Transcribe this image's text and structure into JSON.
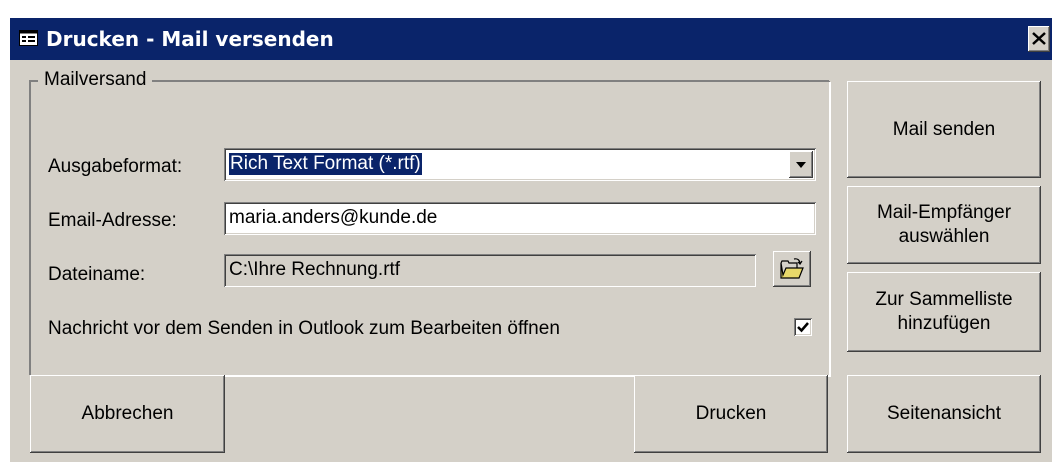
{
  "window": {
    "title": "Drucken - Mail versenden",
    "icon": "form-icon",
    "close_label": "close"
  },
  "group": {
    "legend": "Mailversand"
  },
  "format": {
    "label": "Ausgabeformat:",
    "value": "Rich Text Format (*.rtf)"
  },
  "email": {
    "label": "Email-Adresse:",
    "value": "maria.anders@kunde.de"
  },
  "file": {
    "label": "Dateiname:",
    "value": "C:\\Ihre Rechnung.rtf",
    "browse_icon": "open-folder-icon"
  },
  "outlook": {
    "label": "Nachricht vor dem Senden in Outlook zum Bearbeiten öffnen",
    "checked": true
  },
  "buttons": {
    "send_mail": "Mail senden",
    "select_recipient": "Mail-Empfänger\nauswählen",
    "add_to_list": "Zur Sammelliste\nhinzufügen",
    "cancel": "Abbrechen",
    "print": "Drucken",
    "preview": "Seitenansicht"
  }
}
